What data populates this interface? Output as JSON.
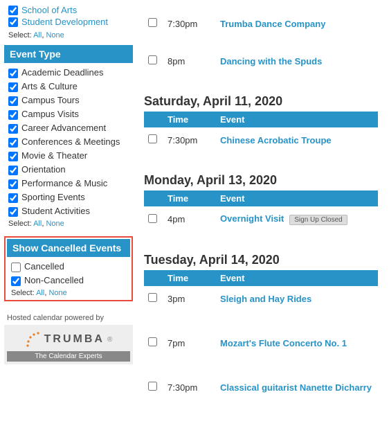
{
  "sidebar": {
    "topLinks": [
      {
        "label": "School of Arts",
        "checked": true
      },
      {
        "label": "Student Development",
        "checked": true
      }
    ],
    "selectText": "Select:",
    "allText": "All",
    "noneText": "None",
    "eventTypeHeader": "Event Type",
    "eventTypes": [
      "Academic Deadlines",
      "Arts & Culture",
      "Campus Tours",
      "Campus Visits",
      "Career Advancement",
      "Conferences & Meetings",
      "Movie & Theater",
      "Orientation",
      "Performance & Music",
      "Sporting Events",
      "Student Activities"
    ],
    "cancelledHeader": "Show Cancelled Events",
    "cancelledOptions": [
      {
        "label": "Cancelled",
        "checked": false
      },
      {
        "label": "Non-Cancelled",
        "checked": true
      }
    ],
    "poweredText": "Hosted calendar powered by",
    "trumbaName": "TRUMBA",
    "trumbaTagline": "The Calendar Experts"
  },
  "columns": {
    "time": "Time",
    "event": "Event"
  },
  "days": [
    {
      "heading": "",
      "events": [
        {
          "time": "7:30pm",
          "title": "Trumba Dance Company"
        },
        {
          "time": "8pm",
          "title": "Dancing with the Spuds"
        }
      ]
    },
    {
      "heading": "Saturday, April 11, 2020",
      "events": [
        {
          "time": "7:30pm",
          "title": "Chinese Acrobatic Troupe"
        }
      ]
    },
    {
      "heading": "Monday, April 13, 2020",
      "events": [
        {
          "time": "4pm",
          "title": "Overnight Visit",
          "badge": "Sign Up Closed"
        }
      ]
    },
    {
      "heading": "Tuesday, April 14, 2020",
      "events": [
        {
          "time": "3pm",
          "title": "Sleigh and Hay Rides"
        },
        {
          "time": "7pm",
          "title": "Mozart's Flute Concerto No. 1"
        },
        {
          "time": "7:30pm",
          "title": "Classical guitarist Nanette Dicharry"
        }
      ]
    }
  ]
}
